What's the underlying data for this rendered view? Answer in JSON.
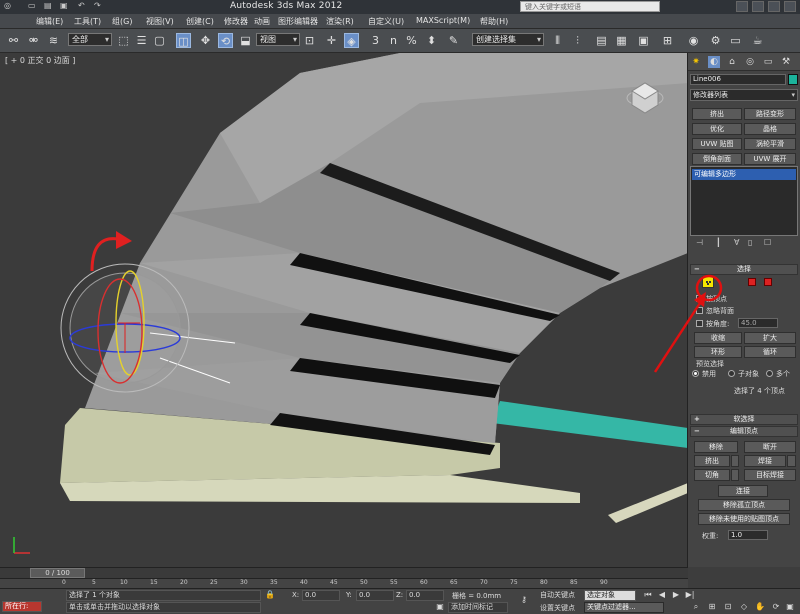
{
  "titlebar": {
    "app_title": "Autodesk 3ds Max  2012",
    "search_placeholder": "键入关键字或短语"
  },
  "menubar": {
    "items": [
      "编辑(E)",
      "工具(T)",
      "组(G)",
      "视图(V)",
      "创建(C)",
      "修改器",
      "动画",
      "图形编辑器",
      "渲染(R)",
      "自定义(U)",
      "MAXScript(M)",
      "帮助(H)"
    ]
  },
  "toolbar": {
    "filter_combo": "全部",
    "ref_coord_combo": "视图",
    "named_selection_combo": "创建选择集",
    "snap_label": "3",
    "angle_label": "n"
  },
  "viewport": {
    "label": "[ + 0 正交 0 边面 ]"
  },
  "command_panel": {
    "object_name": "Line006",
    "object_color": "#1bb39b",
    "modifier_list": "修改器列表",
    "mod_buttons": [
      "挤出",
      "路径变形",
      "优化",
      "晶格",
      "UVW 贴图",
      "涡轮平滑",
      "倒角剖面",
      "UVW 展开"
    ],
    "stack_item": "可编辑多边形",
    "selection": {
      "header": "选择",
      "by_vertex": "按顶点",
      "ignore_backfacing": "忽略背面",
      "by_angle": "按角度:",
      "angle_value": "45.0",
      "shrink": "收缩",
      "grow": "扩大",
      "ring": "环形",
      "loop": "循环",
      "preview_selection": "预览选择",
      "disabled": "禁用",
      "sub_object": "子对象",
      "multi": "多个",
      "selected_info": "选择了 4 个顶点"
    },
    "soft_selection": "软选择",
    "edit_vertices": {
      "header": "编辑顶点",
      "remove": "移除",
      "break": "断开",
      "extrude": "挤出",
      "weld": "焊接",
      "chamfer": "切角",
      "target_weld": "目标焊接",
      "connect": "连接",
      "remove_isolated": "移除孤立顶点",
      "remove_unused_map": "移除未使用的贴图顶点",
      "weight_label": "权重:",
      "weight_value": "1.0"
    }
  },
  "timeline": {
    "frame_display": "0 / 100",
    "ruler_labels": [
      "0",
      "5",
      "10",
      "15",
      "20",
      "25",
      "30",
      "35",
      "40",
      "45",
      "50",
      "55",
      "60",
      "65",
      "70",
      "75",
      "80",
      "85",
      "90"
    ]
  },
  "status": {
    "mode": "所在行:",
    "message_top": "选择了 1 个对象",
    "message_bottom": "单击或单击并拖动以选择对象",
    "x_label": "X:",
    "x_value": "0.0",
    "y_label": "Y:",
    "y_value": "0.0",
    "z_label": "Z:",
    "z_value": "0.0",
    "grid": "栅格 = 0.0mm",
    "auto_key": "自动关键点",
    "selected_object": "选定对象",
    "set_key": "设置关键点",
    "key_filters": "关键点过滤器...",
    "add_time_tag": "添加时间标记"
  }
}
